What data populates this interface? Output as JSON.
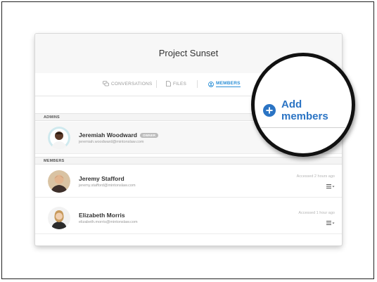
{
  "project": {
    "title": "Project Sunset"
  },
  "tabs": [
    {
      "label": "CONVERSATIONS",
      "icon": "chat-bubbles-icon",
      "active": false
    },
    {
      "label": "FILES",
      "icon": "file-icon",
      "active": false
    },
    {
      "label": "MEMBERS",
      "icon": "user-circle-icon",
      "active": true
    }
  ],
  "sections": {
    "admins": "ADMINS",
    "members": "MEMBERS"
  },
  "admins": [
    {
      "name": "Jeremiah Woodward",
      "badge": "OWNER",
      "email": "jeremiah.woodward@mintonslaw.com"
    }
  ],
  "members": [
    {
      "name": "Jeremy Stafford",
      "email": "jeremy.stafford@mintonslaw.com",
      "accessed": "Accessed 2 hours ago"
    },
    {
      "name": "Elizabeth Morris",
      "email": "elizabeth.morris@mintonslaw.com",
      "accessed": "Accessed 1 hour ago"
    }
  ],
  "add_members": {
    "label": "Add members",
    "icon": "plus-circle-icon"
  },
  "colors": {
    "accent": "#2b74c4",
    "tab_active": "#2b8fd6",
    "border": "#111111"
  }
}
